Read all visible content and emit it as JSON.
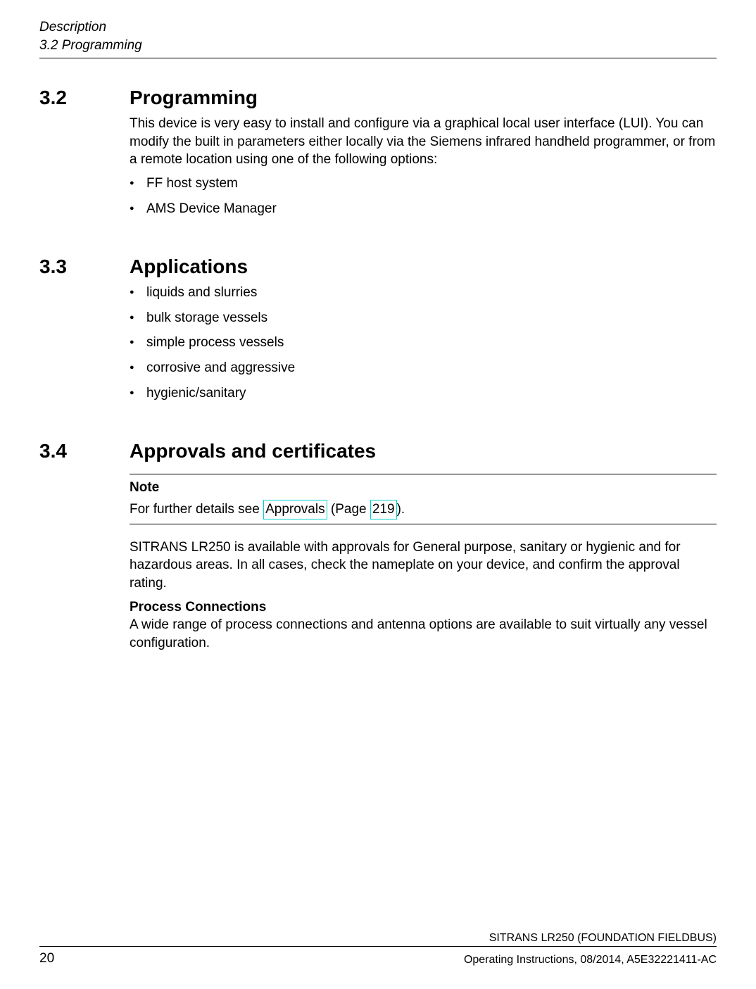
{
  "header": {
    "chapter": "Description",
    "section": "3.2 Programming"
  },
  "sections": [
    {
      "num": "3.2",
      "title": "Programming",
      "intro": "This device is very easy to install and configure via a graphical local user interface (LUI). You can modify the built in parameters either locally via the Siemens infrared handheld programmer, or from a remote location using one of the following options:",
      "bullets": [
        "FF host system",
        "AMS Device Manager"
      ]
    },
    {
      "num": "3.3",
      "title": "Applications",
      "bullets": [
        "liquids and slurries",
        "bulk storage vessels",
        "simple process vessels",
        "corrosive and aggressive",
        "hygienic/sanitary"
      ]
    },
    {
      "num": "3.4",
      "title": "Approvals and certificates",
      "note": {
        "label": "Note",
        "prefix": "For further details see ",
        "link_text": "Approvals",
        "mid": " (Page ",
        "page_link": "219",
        "suffix": ")."
      },
      "body1": "SITRANS LR250 is available with approvals for General purpose, sanitary or hygienic and for hazardous areas. In all cases, check the nameplate on your device, and confirm the approval rating.",
      "subhead": "Process Connections",
      "body2": "A wide range of process connections and antenna options are available to suit virtually any vessel configuration."
    }
  ],
  "footer": {
    "page": "20",
    "product": "SITRANS LR250 (FOUNDATION FIELDBUS)",
    "docinfo": "Operating Instructions, 08/2014, A5E32221411-AC"
  }
}
